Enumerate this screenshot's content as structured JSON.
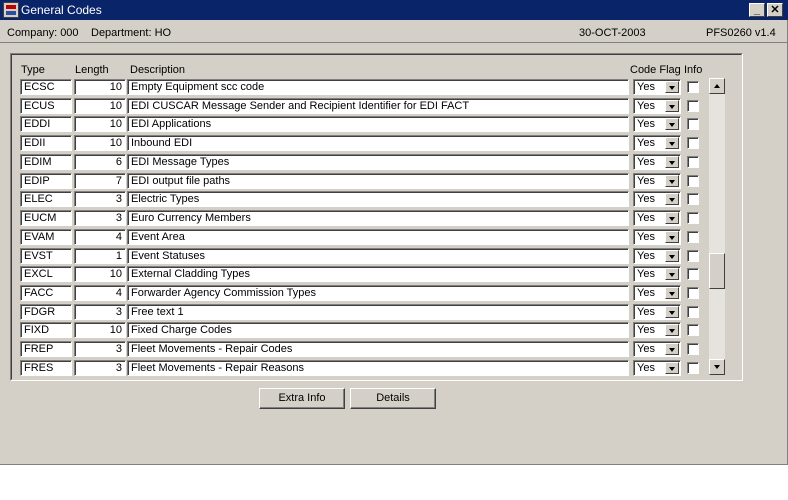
{
  "window": {
    "title": "General Codes"
  },
  "statusline": {
    "company": "Company:  000",
    "department": "Department:  HO",
    "date": "30-OCT-2003",
    "module": "PFS0260  v1.4"
  },
  "table": {
    "columns": {
      "type": "Type",
      "length": "Length",
      "description": "Description",
      "code_flag": "Code Flag",
      "info": "Info"
    },
    "rows": [
      {
        "type": "ECSC",
        "length": "10",
        "description": "Empty Equipment scc code",
        "flag": "Yes",
        "info": false
      },
      {
        "type": "ECUS",
        "length": "10",
        "description": "EDI CUSCAR Message Sender and Recipient Identifier for EDI FACT",
        "flag": "Yes",
        "info": false
      },
      {
        "type": "EDDI",
        "length": "10",
        "description": "EDI Applications",
        "flag": "Yes",
        "info": false
      },
      {
        "type": "EDII",
        "length": "10",
        "description": "Inbound EDI",
        "flag": "Yes",
        "info": false
      },
      {
        "type": "EDIM",
        "length": "6",
        "description": "EDI Message Types",
        "flag": "Yes",
        "info": false
      },
      {
        "type": "EDIP",
        "length": "7",
        "description": "EDI output file paths",
        "flag": "Yes",
        "info": false
      },
      {
        "type": "ELEC",
        "length": "3",
        "description": "Electric Types",
        "flag": "Yes",
        "info": false
      },
      {
        "type": "EUCM",
        "length": "3",
        "description": "Euro Currency Members",
        "flag": "Yes",
        "info": false
      },
      {
        "type": "EVAM",
        "length": "4",
        "description": "Event Area",
        "flag": "Yes",
        "info": false
      },
      {
        "type": "EVST",
        "length": "1",
        "description": "Event Statuses",
        "flag": "Yes",
        "info": false
      },
      {
        "type": "EXCL",
        "length": "10",
        "description": "External Cladding Types",
        "flag": "Yes",
        "info": false
      },
      {
        "type": "FACC",
        "length": "4",
        "description": "Forwarder Agency Commission Types",
        "flag": "Yes",
        "info": false
      },
      {
        "type": "FDGR",
        "length": "3",
        "description": "Free text 1",
        "flag": "Yes",
        "info": false
      },
      {
        "type": "FIXD",
        "length": "10",
        "description": "Fixed Charge Codes",
        "flag": "Yes",
        "info": false
      },
      {
        "type": "FREP",
        "length": "3",
        "description": "Fleet Movements - Repair Codes",
        "flag": "Yes",
        "info": false
      },
      {
        "type": "FRES",
        "length": "3",
        "description": "Fleet Movements - Repair Reasons",
        "flag": "Yes",
        "info": false
      }
    ]
  },
  "buttons": {
    "extra_info": "Extra Info",
    "details": "Details"
  },
  "icons": {
    "app": "app-icon",
    "minimize": "minimize-icon",
    "close": "close-icon"
  }
}
